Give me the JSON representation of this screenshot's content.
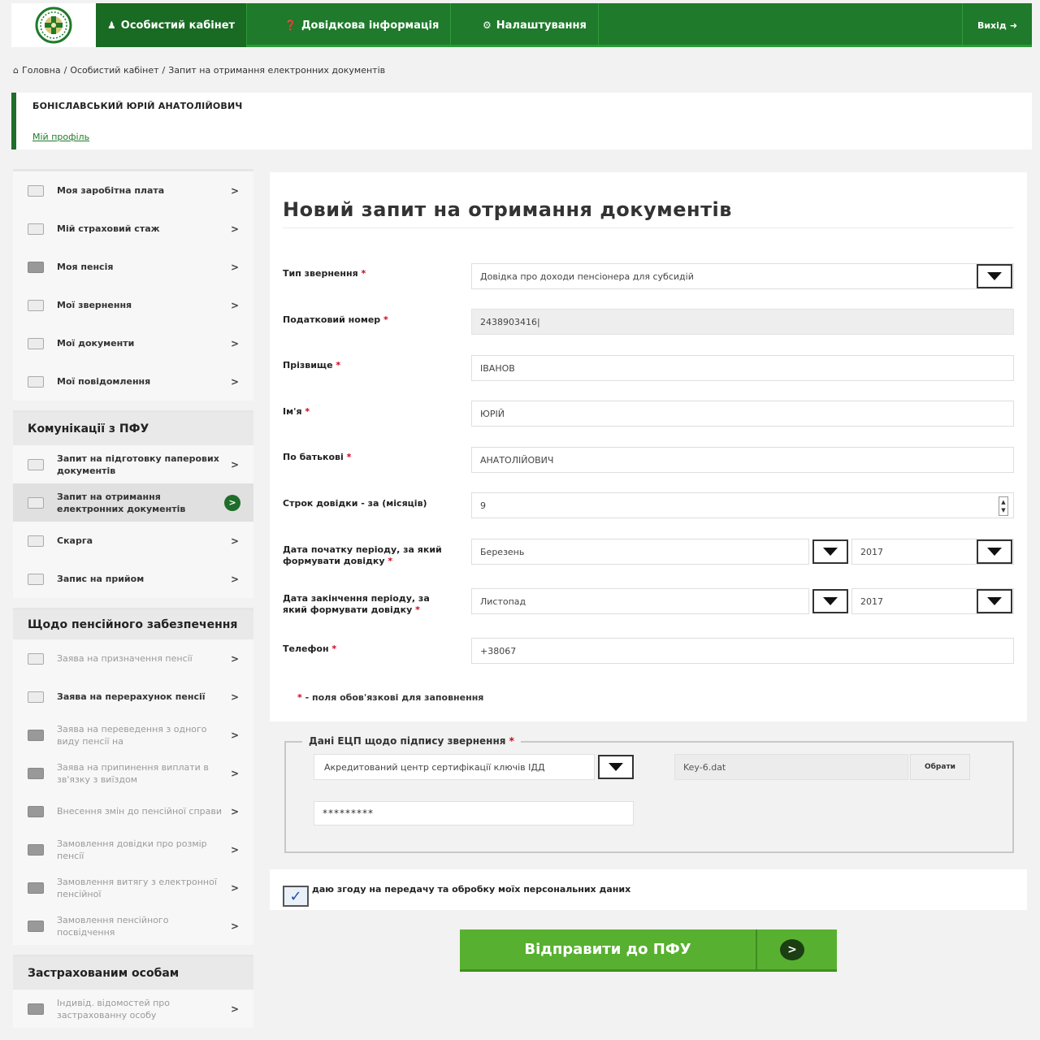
{
  "nav": {
    "cabinet": "Особистий кабінет",
    "info": "Довідкова інформація",
    "settings": "Налаштування",
    "exit": "Вихід"
  },
  "breadcrumb": [
    "Головна",
    "Особистий кабінет",
    "Запит на отримання електронних документів"
  ],
  "user": {
    "name": "БОНІСЛАВСЬКИЙ ЮРІЙ АНАТОЛІЙОВИЧ",
    "profile_link": "Мій профіль"
  },
  "sidebar": {
    "personal": [
      {
        "label": "Моя заробітна плата"
      },
      {
        "label": "Мій страховий стаж"
      },
      {
        "label": "Моя пенсія"
      },
      {
        "label": "Мої звернення"
      },
      {
        "label": "Мої документи"
      },
      {
        "label": "Мої повідомлення"
      }
    ],
    "communications": {
      "title": "Комунікації з ПФУ",
      "items": [
        {
          "label": "Запит на підготовку паперових документів"
        },
        {
          "label": "Запит на отримання електронних документів"
        },
        {
          "label": "Скарга"
        },
        {
          "label": "Запис на прийом"
        }
      ]
    },
    "pension": {
      "title": "Щодо пенсійного забезпечення",
      "items": [
        {
          "label": "Заява на призначення пенсії"
        },
        {
          "label": "Заява на перерахунок пенсії"
        },
        {
          "label": "Заява на переведення з одного виду пенсії на"
        },
        {
          "label": "Заява на припинення виплати в зв'язку з виїздом"
        },
        {
          "label": "Внесення змін до пенсійної справи"
        },
        {
          "label": "Замовлення довідки про розмір пенсії"
        },
        {
          "label": "Замовлення витягу з електронної пенсійної"
        },
        {
          "label": "Замовлення пенсійного посвідчення"
        }
      ]
    },
    "insured": {
      "title": "Застрахованим особам",
      "items": [
        {
          "label": "Індивід. відомостей про застрахованну особу"
        }
      ]
    }
  },
  "form": {
    "title": "Новий запит на отримання документів",
    "fields": {
      "request_type": {
        "label": "Тип звернення",
        "value": "Довідка про доходи пенсіонера для субсидій"
      },
      "tax_number": {
        "label": "Податковий номер",
        "value": "2438903416"
      },
      "surname": {
        "label": "Прізвище",
        "value": "ІВАНОВ"
      },
      "name": {
        "label": "Ім'я",
        "value": "ЮРІЙ"
      },
      "patronymic": {
        "label": "По батькові",
        "value": "АНАТОЛІЙОВИЧ"
      },
      "period": {
        "label": "Строк довідки - за (місяців)",
        "value": "9"
      },
      "start_date": {
        "label": "Дата початку періоду, за який формувати довідку",
        "month": "Березень",
        "year": "2017"
      },
      "end_date": {
        "label": "Дата закінчення періоду, за який формувати довідку",
        "month": "Листопад",
        "year": "2017"
      },
      "phone": {
        "label": "Телефон",
        "value": "+38067"
      }
    },
    "required_note": "- поля обов'язкові для заповнення",
    "required_mark": "*"
  },
  "signature": {
    "legend": "Дані ЕЦП щодо підпису звернення",
    "center": "Акредитований центр сертифікації ключів ІДД",
    "file": "Key-6.dat",
    "browse": "Обрати",
    "password": "*********"
  },
  "consent": {
    "text": "даю згоду на передачу та обробку моїх персональних даних",
    "checked": true
  },
  "submit": {
    "label": "Відправити до ПФУ"
  },
  "colors": {
    "nav_green": "#1f7a2b",
    "submit_green": "#58b030",
    "required_red": "#d0021b"
  }
}
